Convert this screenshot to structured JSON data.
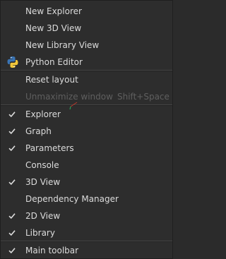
{
  "menu": {
    "items": [
      {
        "label": "New Explorer"
      },
      {
        "label": "New 3D View"
      },
      {
        "label": "New Library View"
      },
      {
        "label": "Python Editor",
        "icon": "python-icon"
      },
      {
        "label": "Reset layout"
      },
      {
        "label": "Unmaximize window",
        "shortcut": "Shift+Space",
        "enabled": false
      },
      {
        "label": "Explorer",
        "checked": true
      },
      {
        "label": "Graph",
        "checked": true
      },
      {
        "label": "Parameters",
        "checked": true
      },
      {
        "label": "Console",
        "checked": false
      },
      {
        "label": "3D View",
        "checked": true
      },
      {
        "label": "Dependency Manager",
        "checked": false
      },
      {
        "label": "2D View",
        "checked": true
      },
      {
        "label": "Library",
        "checked": true
      },
      {
        "label": "Main toolbar",
        "checked": true
      }
    ]
  },
  "colors": {
    "background": "#2d2d2d",
    "text": "#dcdcdc",
    "disabled_text": "#5f5f5f",
    "separator": "#454545",
    "python_blue": "#3a74b4",
    "python_yellow": "#f2c73a"
  }
}
